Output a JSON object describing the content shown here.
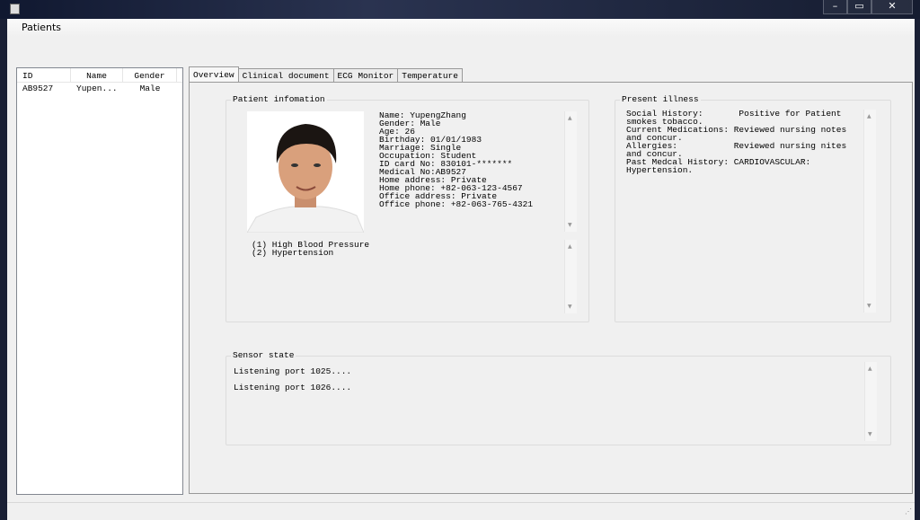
{
  "window": {
    "menu": "Patients",
    "minimize": "–",
    "maximize": "▭",
    "close": "✕"
  },
  "list": {
    "columns": [
      "ID",
      "Name",
      "Gender"
    ],
    "rows": [
      {
        "id": "AB9527",
        "name": "Yupen...",
        "gender": "Male"
      }
    ]
  },
  "tabs": [
    "Overview",
    "Clinical document",
    "ECG Monitor",
    "Temperature"
  ],
  "patient_info": {
    "title": "Patient infomation",
    "lines": [
      "Name: YupengZhang",
      "Gender: Male",
      "Age: 26",
      "Birthday: 01/01/1983",
      "Marriage: Single",
      "Occupation: Student",
      "ID card No: 830101-*******",
      "Medical No:AB9527",
      "Home address: Private",
      "Home phone: +82-063-123-4567",
      "Office address: Private",
      "Office phone: +82-063-765-4321"
    ],
    "conditions": [
      "(1) High Blood Pressure",
      "(2) Hypertension"
    ]
  },
  "present_illness": {
    "title": "Present illness",
    "lines": [
      "Social History:       Positive for Patient",
      "smokes tobacco.",
      "Current Medications: Reviewed nursing notes",
      "and concur.",
      "Allergies:           Reviewed nursing nites",
      "and concur.",
      "Past Medcal History: CARDIOVASCULAR:",
      "Hypertension."
    ]
  },
  "sensor": {
    "title": "Sensor state",
    "lines": [
      "Listening port 1025....",
      "Listening port 1026...."
    ]
  }
}
